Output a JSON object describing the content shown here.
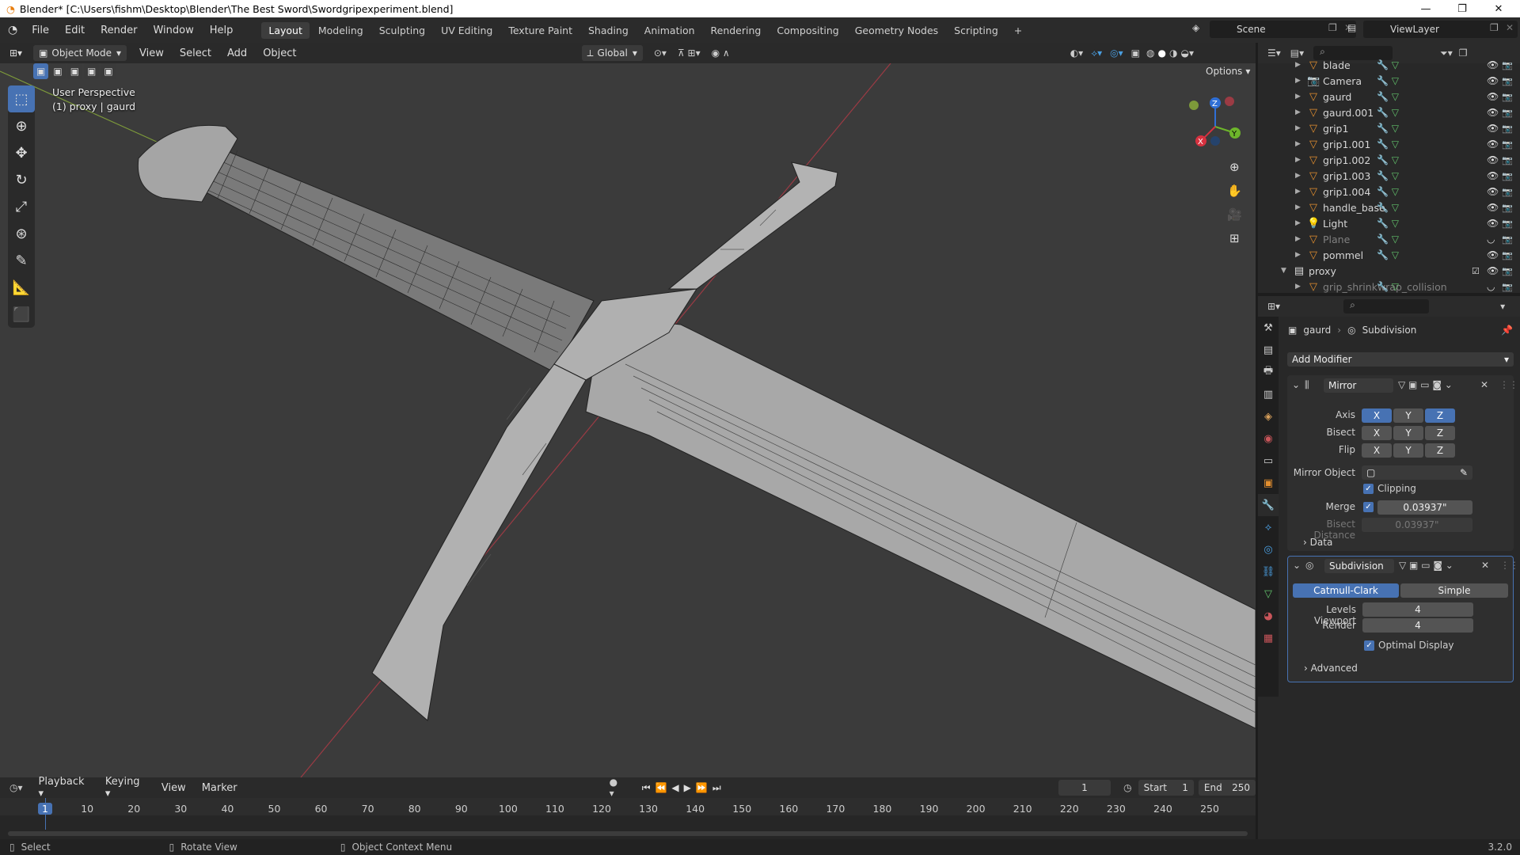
{
  "window": {
    "title": "Blender* [C:\\Users\\fishm\\Desktop\\Blender\\The Best Sword\\Swordgripexperiment.blend]",
    "controls": [
      "—",
      "❐",
      "✕"
    ]
  },
  "menus": [
    "File",
    "Edit",
    "Render",
    "Window",
    "Help"
  ],
  "workspaces": [
    "Layout",
    "Modeling",
    "Sculpting",
    "UV Editing",
    "Texture Paint",
    "Shading",
    "Animation",
    "Rendering",
    "Compositing",
    "Geometry Nodes",
    "Scripting"
  ],
  "active_workspace": "Layout",
  "scene": "Scene",
  "view_layer": "ViewLayer",
  "viewport_header": {
    "mode": "Object Mode",
    "menus": [
      "View",
      "Select",
      "Add",
      "Object"
    ],
    "orientation": "Global",
    "options": "Options"
  },
  "viewport_info": {
    "line1": "User Perspective",
    "line2": "(1) proxy | gaurd"
  },
  "gizmo": {
    "x": "X",
    "y": "Y",
    "z": "Z"
  },
  "outliner": {
    "rows": [
      {
        "name": "blade",
        "type": "mesh",
        "dim": false
      },
      {
        "name": "Camera",
        "type": "camera",
        "dim": false
      },
      {
        "name": "gaurd",
        "type": "mesh",
        "dim": false
      },
      {
        "name": "gaurd.001",
        "type": "mesh",
        "dim": false
      },
      {
        "name": "grip1",
        "type": "mesh",
        "dim": false
      },
      {
        "name": "grip1.001",
        "type": "mesh",
        "dim": false
      },
      {
        "name": "grip1.002",
        "type": "mesh",
        "dim": false
      },
      {
        "name": "grip1.003",
        "type": "mesh",
        "dim": false
      },
      {
        "name": "grip1.004",
        "type": "mesh",
        "dim": false
      },
      {
        "name": "handle_base",
        "type": "mesh",
        "dim": false
      },
      {
        "name": "Light",
        "type": "light",
        "dim": false
      },
      {
        "name": "Plane",
        "type": "mesh",
        "dim": true
      },
      {
        "name": "pommel",
        "type": "mesh",
        "dim": false
      },
      {
        "name": "proxy",
        "type": "collection",
        "dim": false
      },
      {
        "name": "grip_shrinkwrap_collision",
        "type": "mesh",
        "dim": true
      }
    ]
  },
  "properties": {
    "breadcrumb_object": "gaurd",
    "breadcrumb_modifier": "Subdivision",
    "add_modifier": "Add Modifier",
    "mirror": {
      "name": "Mirror",
      "axis_label": "Axis",
      "bisect_label": "Bisect",
      "flip_label": "Flip",
      "axes": [
        "X",
        "Y",
        "Z"
      ],
      "axis_active": [
        true,
        false,
        true
      ],
      "mirror_object_label": "Mirror Object",
      "clipping": "Clipping",
      "merge_label": "Merge",
      "merge_value": "0.03937\"",
      "bisect_distance_label": "Bisect Distance",
      "bisect_distance_value": "0.03937\"",
      "data_label": "Data"
    },
    "subdivision": {
      "name": "Subdivision",
      "catmull": "Catmull-Clark",
      "simple": "Simple",
      "levels_label": "Levels Viewport",
      "levels_value": "4",
      "render_label": "Render",
      "render_value": "4",
      "optimal": "Optimal Display",
      "advanced": "Advanced"
    }
  },
  "timeline": {
    "menus": [
      "Playback",
      "Keying",
      "View",
      "Marker"
    ],
    "current_frame": "1",
    "start_label": "Start",
    "start": "1",
    "end_label": "End",
    "end": "250",
    "ticks": [
      "1",
      "10",
      "20",
      "30",
      "40",
      "50",
      "60",
      "70",
      "80",
      "90",
      "100",
      "110",
      "120",
      "130",
      "140",
      "150",
      "160",
      "170",
      "180",
      "190",
      "200",
      "210",
      "220",
      "230",
      "240",
      "250"
    ]
  },
  "statusbar": {
    "select": "Select",
    "rotate": "Rotate View",
    "context": "Object Context Menu",
    "version": "3.2.0"
  }
}
